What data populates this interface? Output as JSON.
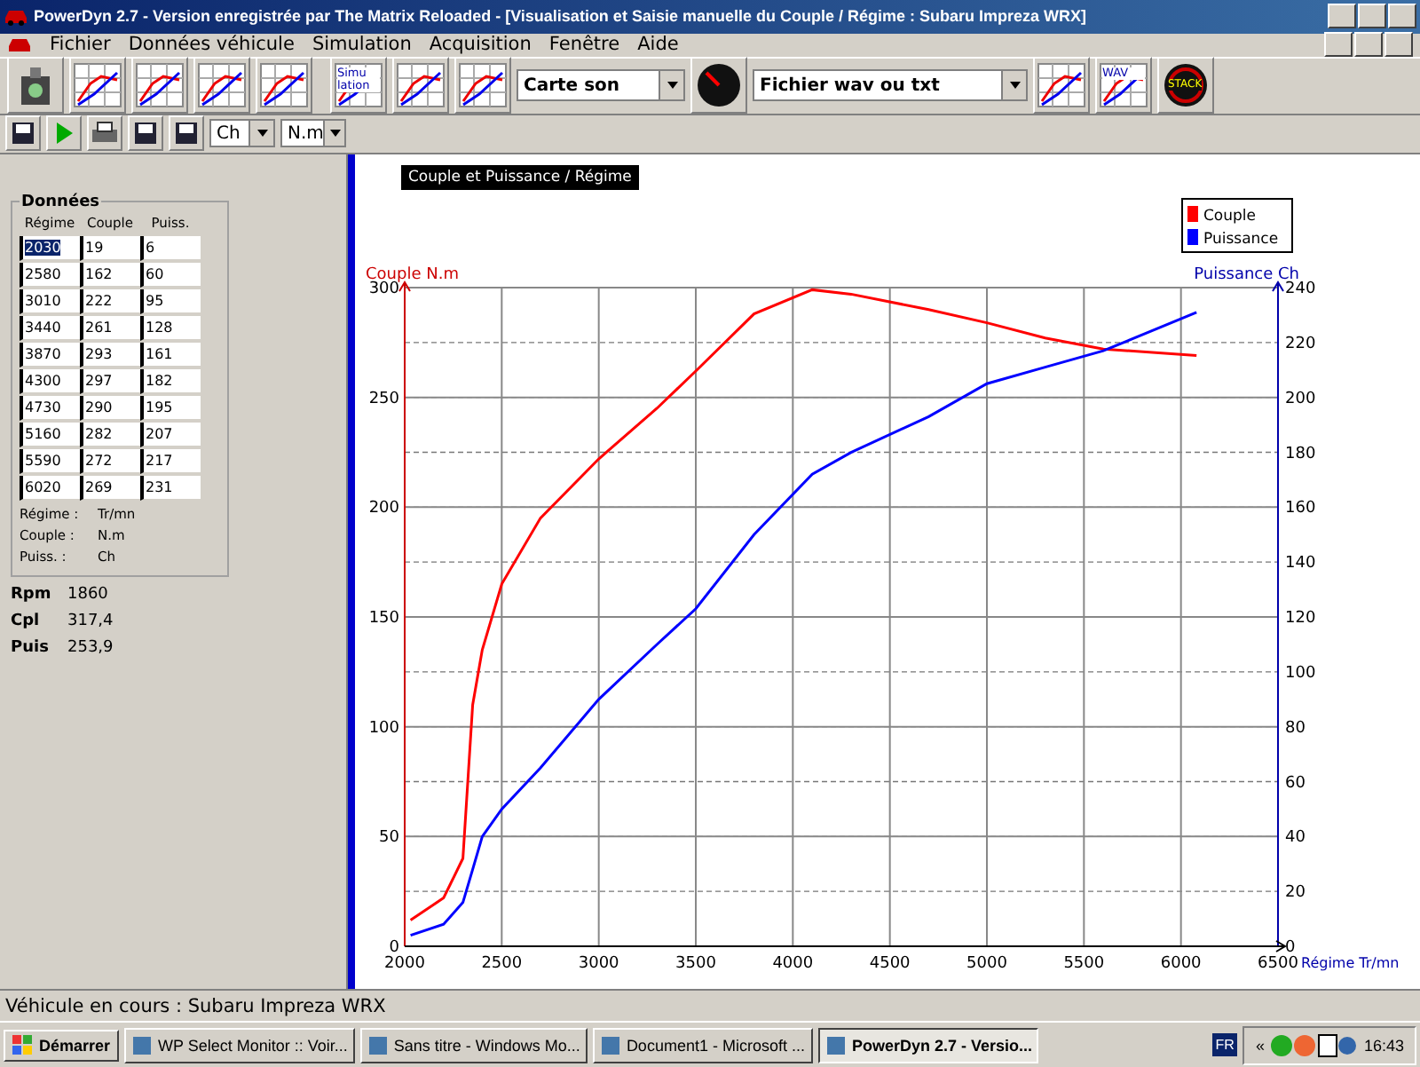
{
  "window": {
    "title": "PowerDyn 2.7 - Version enregistrée par The Matrix Reloaded - [Visualisation et Saisie manuelle du Couple / Régime : Subaru Impreza WRX]"
  },
  "menu": [
    "Fichier",
    "Données véhicule",
    "Simulation",
    "Acquisition",
    "Fenêtre",
    "Aide"
  ],
  "toolbar": [
    {
      "kind": "button"
    },
    {
      "kind": "button"
    },
    {
      "kind": "button"
    },
    {
      "kind": "button"
    },
    {
      "kind": "button"
    },
    {
      "kind": "gap"
    },
    {
      "kind": "button",
      "label": "Simu lation"
    },
    {
      "kind": "button"
    },
    {
      "kind": "button"
    },
    {
      "kind": "select",
      "value": "Carte son"
    },
    {
      "kind": "button"
    },
    {
      "kind": "select",
      "value": "Fichier wav ou txt"
    },
    {
      "kind": "button"
    },
    {
      "kind": "button",
      "label": "WAV"
    },
    {
      "kind": "button",
      "label": "STACK"
    }
  ],
  "toolbar2": [
    {
      "kind": "button"
    },
    {
      "kind": "button"
    },
    {
      "kind": "button"
    },
    {
      "kind": "button"
    },
    {
      "kind": "button"
    },
    {
      "kind": "select",
      "value": "Ch"
    },
    {
      "kind": "select",
      "value": "N.m"
    }
  ],
  "data_panel": {
    "title": "Données",
    "columns": [
      "Régime",
      "Couple",
      "Puiss."
    ],
    "rows": [
      {
        "cells": [
          "2030",
          "19",
          "6"
        ],
        "selected": true
      },
      {
        "cells": [
          "2580",
          "162",
          "60"
        ],
        "selected": false
      },
      {
        "cells": [
          "3010",
          "222",
          "95"
        ],
        "selected": false
      },
      {
        "cells": [
          "3440",
          "261",
          "128"
        ],
        "selected": false
      },
      {
        "cells": [
          "3870",
          "293",
          "161"
        ],
        "selected": false
      },
      {
        "cells": [
          "4300",
          "297",
          "182"
        ],
        "selected": false
      },
      {
        "cells": [
          "4730",
          "290",
          "195"
        ],
        "selected": false
      },
      {
        "cells": [
          "5160",
          "282",
          "207"
        ],
        "selected": false
      },
      {
        "cells": [
          "5590",
          "272",
          "217"
        ],
        "selected": false
      },
      {
        "cells": [
          "6020",
          "269",
          "231"
        ],
        "selected": false
      }
    ],
    "units": [
      {
        "name": "Régime :",
        "unit": "Tr/mn"
      },
      {
        "name": "Couple :",
        "unit": "N.m"
      },
      {
        "name": "Puiss. :",
        "unit": "Ch"
      }
    ]
  },
  "readouts": [
    {
      "name": "Rpm",
      "value": "1860"
    },
    {
      "name": "Cpl",
      "value": "317,4"
    },
    {
      "name": "Puis",
      "value": "253,9"
    }
  ],
  "chart": {
    "chart_data": {
      "type": "line",
      "grid": true,
      "legend": "top-right",
      "title": "Couple et Puissance / Régime",
      "xlabel": "Régime Tr/mn",
      "ylabel": "Couple N.m",
      "y2label": "Puissance Ch",
      "x": [
        2030,
        2200,
        2300,
        2350,
        2400,
        2500,
        2700,
        3000,
        3300,
        3500,
        3800,
        4100,
        4300,
        4700,
        5000,
        5300,
        5600,
        6080
      ],
      "series": [
        {
          "name": "Couple",
          "color": "#ff0000",
          "values": [
            12,
            22,
            40,
            110,
            135,
            165,
            195,
            222,
            245,
            262,
            288,
            299,
            297,
            290,
            284,
            277,
            272,
            269
          ]
        },
        {
          "name": "Puissance",
          "color": "#0000ff",
          "axis": "y2",
          "values": [
            4,
            8,
            16,
            28,
            40,
            50,
            65,
            90,
            110,
            123,
            150,
            172,
            180,
            193,
            205,
            211,
            217,
            231
          ]
        }
      ],
      "xlim": [
        2000,
        6500
      ],
      "ylim": [
        0,
        300
      ],
      "y2lim": [
        0,
        240
      ],
      "xticks": [
        2000,
        2500,
        3000,
        3500,
        4000,
        4500,
        5000,
        5500,
        6000,
        6500
      ],
      "yticks": [
        0,
        50,
        100,
        150,
        200,
        250,
        300
      ],
      "y2ticks": [
        0,
        20,
        40,
        60,
        80,
        100,
        120,
        140,
        160,
        180,
        200,
        220,
        240
      ]
    }
  },
  "status_bar": "Véhicule en cours : Subaru Impreza WRX",
  "taskbar": {
    "start": "Démarrer",
    "tasks": [
      {
        "label": "WP Select Monitor :: Voir...",
        "selected": false
      },
      {
        "label": "Sans titre - Windows Mo...",
        "selected": false
      },
      {
        "label": "Document1 - Microsoft ...",
        "selected": false
      },
      {
        "label": "PowerDyn 2.7 - Versio...",
        "selected": true
      }
    ],
    "lang": "FR",
    "chevron": "«",
    "time": "16:43"
  }
}
